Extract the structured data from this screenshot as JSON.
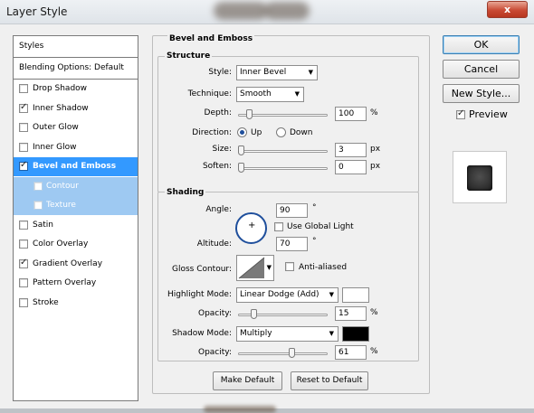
{
  "window": {
    "title": "Layer Style",
    "close_label": "x"
  },
  "sidebar": {
    "header": "Styles",
    "blending": "Blending Options: Default",
    "items": [
      {
        "label": "Drop Shadow",
        "checked": false
      },
      {
        "label": "Inner Shadow",
        "checked": true
      },
      {
        "label": "Outer Glow",
        "checked": false
      },
      {
        "label": "Inner Glow",
        "checked": false
      },
      {
        "label": "Bevel and Emboss",
        "checked": true
      },
      {
        "label": "Contour",
        "checked": false
      },
      {
        "label": "Texture",
        "checked": false
      },
      {
        "label": "Satin",
        "checked": false
      },
      {
        "label": "Color Overlay",
        "checked": false
      },
      {
        "label": "Gradient Overlay",
        "checked": true
      },
      {
        "label": "Pattern Overlay",
        "checked": false
      },
      {
        "label": "Stroke",
        "checked": false
      }
    ]
  },
  "bevel": {
    "title": "Bevel and Emboss",
    "structure": {
      "title": "Structure",
      "style_label": "Style:",
      "style_value": "Inner Bevel",
      "technique_label": "Technique:",
      "technique_value": "Smooth",
      "depth_label": "Depth:",
      "depth_value": "100",
      "depth_unit": "%",
      "direction_label": "Direction:",
      "dir_up": "Up",
      "dir_down": "Down",
      "size_label": "Size:",
      "size_value": "3",
      "size_unit": "px",
      "soften_label": "Soften:",
      "soften_value": "0",
      "soften_unit": "px"
    },
    "shading": {
      "title": "Shading",
      "angle_label": "Angle:",
      "angle_value": "90",
      "angle_unit": "°",
      "global_light": "Use Global Light",
      "altitude_label": "Altitude:",
      "altitude_value": "70",
      "altitude_unit": "°",
      "gloss_label": "Gloss Contour:",
      "anti_aliased": "Anti-aliased",
      "highlight_label": "Highlight Mode:",
      "highlight_value": "Linear Dodge (Add)",
      "highlight_opacity_label": "Opacity:",
      "highlight_opacity_value": "15",
      "highlight_opacity_unit": "%",
      "shadow_label": "Shadow Mode:",
      "shadow_value": "Multiply",
      "shadow_opacity_label": "Opacity:",
      "shadow_opacity_value": "61",
      "shadow_opacity_unit": "%"
    },
    "make_default": "Make Default",
    "reset_default": "Reset to Default"
  },
  "buttons": {
    "ok": "OK",
    "cancel": "Cancel",
    "new_style": "New Style...",
    "preview": "Preview"
  },
  "colors": {
    "accent": "#3399ff",
    "highlight_swatch": "#ffffff",
    "shadow_swatch": "#000000"
  },
  "sliders": {
    "depth": 0.1,
    "size": 0.0,
    "soften": 0.0,
    "highlight_opacity": 0.15,
    "shadow_opacity": 0.61
  }
}
